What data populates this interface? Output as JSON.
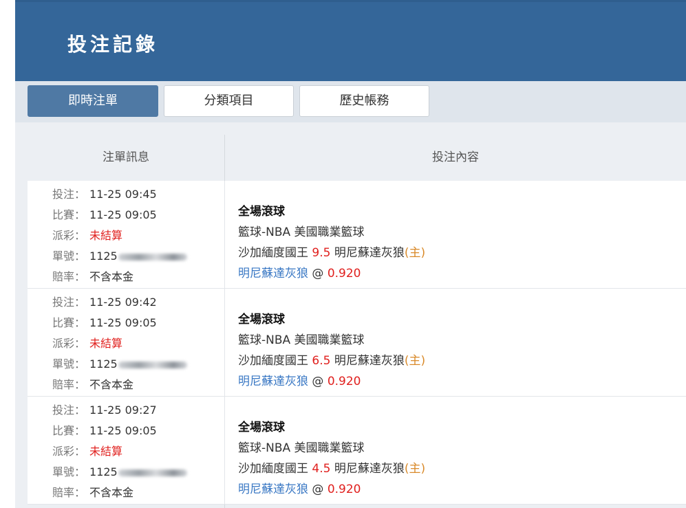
{
  "header": {
    "title": "投注記錄"
  },
  "tabs": [
    {
      "label": "即時注單",
      "active": true
    },
    {
      "label": "分類項目",
      "active": false
    },
    {
      "label": "歷史帳務",
      "active": false
    }
  ],
  "table": {
    "columns": [
      "注單訊息",
      "投注內容"
    ],
    "labels": {
      "bet_time": "投注：",
      "match_time": "比賽：",
      "payout": "派彩：",
      "order_no": "單號：",
      "odds_type": "賠率："
    },
    "rows": [
      {
        "bet_time": "11-25 09:45",
        "match_time": "11-25 09:05",
        "payout": "未結算",
        "order_no": "1125",
        "odds_type": "不含本金",
        "market": "全場滾球",
        "league": "籃球-NBA 美國職業籃球",
        "team_a": "沙加緬度國王",
        "handicap": "9.5",
        "team_b": "明尼蘇達灰狼",
        "home_tag": "(主)",
        "pick": "明尼蘇達灰狼",
        "at": "@",
        "odds": "0.920"
      },
      {
        "bet_time": "11-25 09:42",
        "match_time": "11-25 09:05",
        "payout": "未結算",
        "order_no": "1125",
        "odds_type": "不含本金",
        "market": "全場滾球",
        "league": "籃球-NBA 美國職業籃球",
        "team_a": "沙加緬度國王",
        "handicap": "6.5",
        "team_b": "明尼蘇達灰狼",
        "home_tag": "(主)",
        "pick": "明尼蘇達灰狼",
        "at": "@",
        "odds": "0.920"
      },
      {
        "bet_time": "11-25 09:27",
        "match_time": "11-25 09:05",
        "payout": "未結算",
        "order_no": "1125",
        "odds_type": "不含本金",
        "market": "全場滾球",
        "league": "籃球-NBA 美國職業籃球",
        "team_a": "沙加緬度國王",
        "handicap": "4.5",
        "team_b": "明尼蘇達灰狼",
        "home_tag": "(主)",
        "pick": "明尼蘇達灰狼",
        "at": "@",
        "odds": "0.920"
      }
    ]
  },
  "colors": {
    "header": "#346699",
    "active_tab": "#4f79a4",
    "red": "#e0201e",
    "home_tag": "#d98a2a",
    "pick": "#3a78c4"
  }
}
